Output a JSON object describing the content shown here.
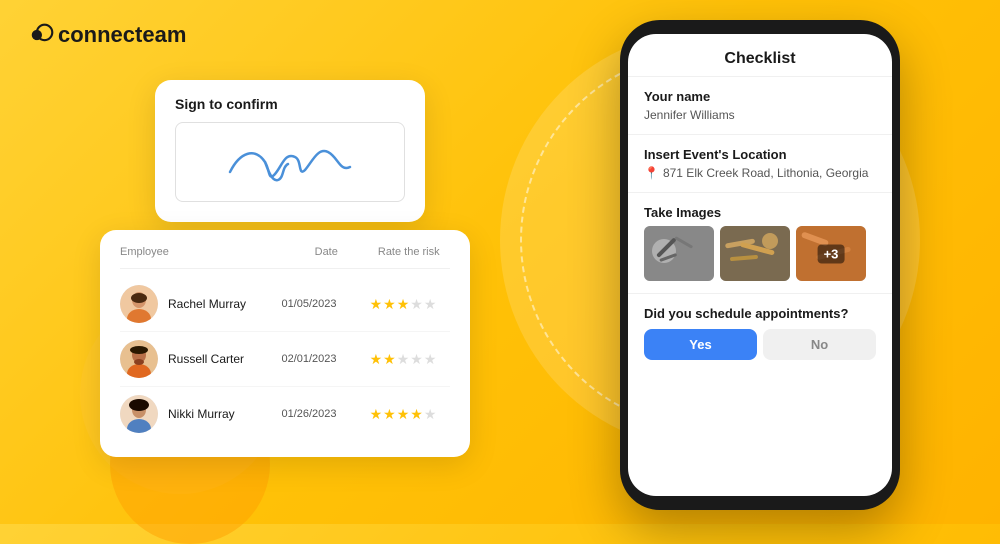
{
  "logo": {
    "text": "connecteam"
  },
  "sign_card": {
    "title": "Sign to confirm"
  },
  "table": {
    "headers": [
      "Employee",
      "Date",
      "Rate the risk"
    ],
    "rows": [
      {
        "name": "Rachel Murray",
        "date": "01/05/2023",
        "stars": 3
      },
      {
        "name": "Russell Carter",
        "date": "02/01/2023",
        "stars": 2
      },
      {
        "name": "Nikki Murray",
        "date": "01/26/2023",
        "stars": 4
      }
    ]
  },
  "phone": {
    "title": "Checklist",
    "sections": {
      "your_name": {
        "label": "Your name",
        "value": "Jennifer Williams"
      },
      "location": {
        "label": "Insert Event's Location",
        "value": "871 Elk Creek Road, Lithonia, Georgia"
      },
      "images": {
        "label": "Take Images",
        "badge": "+3"
      },
      "appointments": {
        "label": "Did you schedule appointments?",
        "yes": "Yes",
        "no": "No"
      }
    }
  }
}
